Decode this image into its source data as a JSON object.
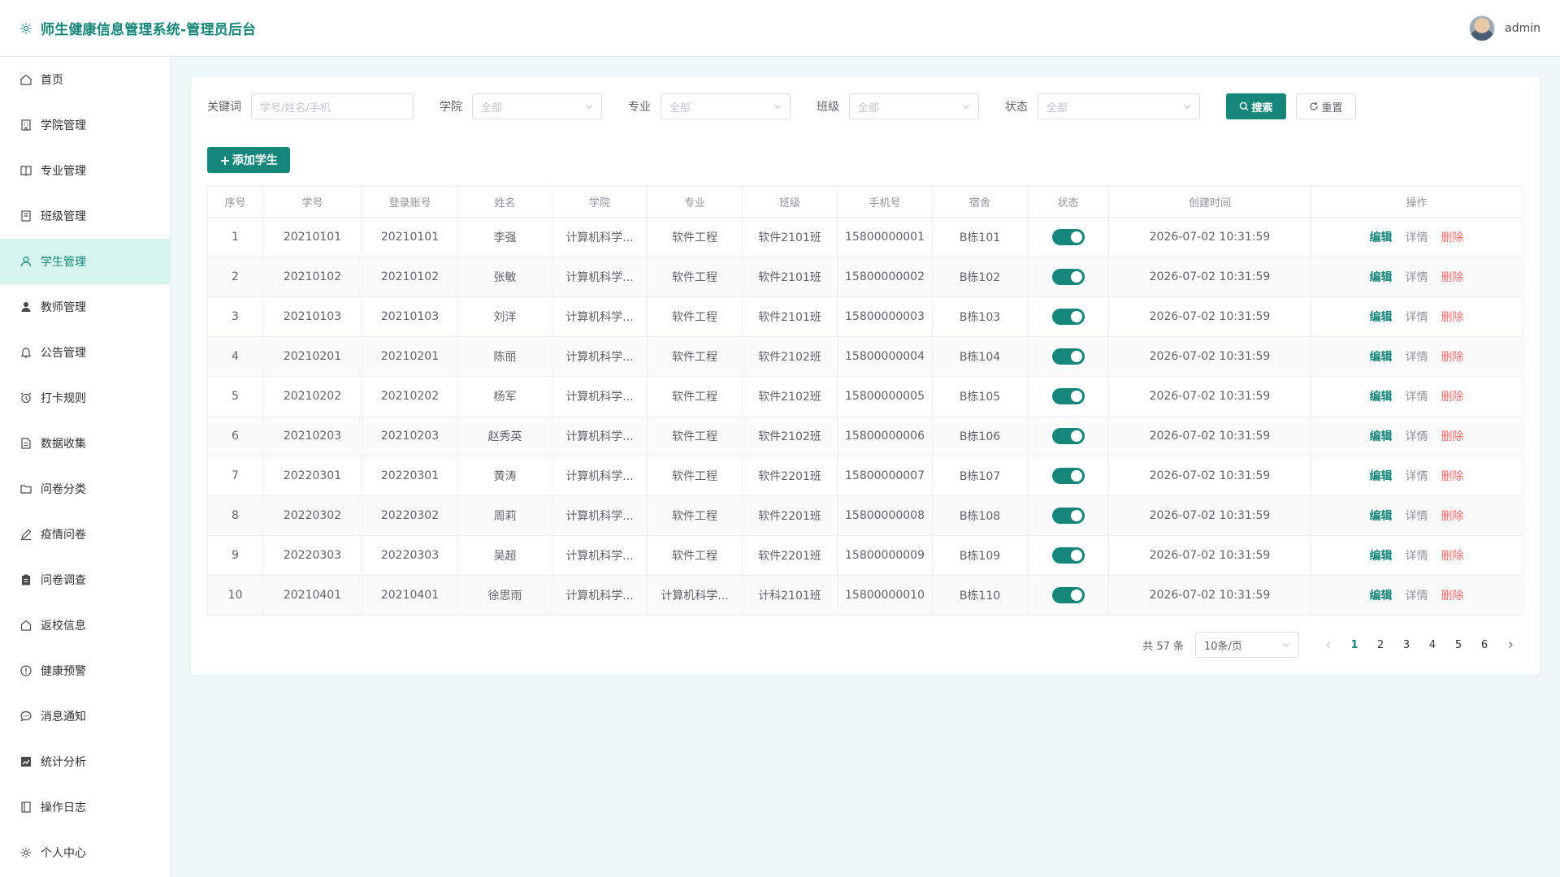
{
  "app": {
    "title": "师生健康信息管理系统-管理员后台"
  },
  "user": {
    "name": "admin"
  },
  "sidebar": {
    "items": [
      {
        "label": "首页",
        "icon": "home-icon"
      },
      {
        "label": "学院管理",
        "icon": "building-icon"
      },
      {
        "label": "专业管理",
        "icon": "book-icon"
      },
      {
        "label": "班级管理",
        "icon": "class-icon"
      },
      {
        "label": "学生管理",
        "icon": "user-icon",
        "active": true
      },
      {
        "label": "教师管理",
        "icon": "teacher-icon"
      },
      {
        "label": "公告管理",
        "icon": "bell-icon"
      },
      {
        "label": "打卡规则",
        "icon": "alarm-icon"
      },
      {
        "label": "数据收集",
        "icon": "document-icon"
      },
      {
        "label": "问卷分类",
        "icon": "folder-icon"
      },
      {
        "label": "疫情问卷",
        "icon": "pen-icon"
      },
      {
        "label": "问卷调查",
        "icon": "clipboard-icon"
      },
      {
        "label": "返校信息",
        "icon": "house-icon"
      },
      {
        "label": "健康预警",
        "icon": "warning-icon"
      },
      {
        "label": "消息通知",
        "icon": "message-icon"
      },
      {
        "label": "统计分析",
        "icon": "chart-icon"
      },
      {
        "label": "操作日志",
        "icon": "log-icon"
      },
      {
        "label": "个人中心",
        "icon": "gear-icon"
      }
    ]
  },
  "filters": {
    "keyword_label": "关键词",
    "keyword_placeholder": "学号/姓名/手机",
    "college_label": "学院",
    "college_value": "全部",
    "major_label": "专业",
    "major_value": "全部",
    "class_label": "班级",
    "class_value": "全部",
    "status_label": "状态",
    "status_value": "全部",
    "search_label": "搜索",
    "reset_label": "重置"
  },
  "add_button_label": "添加学生",
  "table": {
    "headers": [
      "序号",
      "学号",
      "登录账号",
      "姓名",
      "学院",
      "专业",
      "班级",
      "手机号",
      "宿舍",
      "状态",
      "创建时间",
      "操作"
    ],
    "actions": {
      "edit": "编辑",
      "detail": "详情",
      "delete": "删除"
    },
    "rows": [
      {
        "idx": "1",
        "sid": "20210101",
        "account": "20210101",
        "name": "李强",
        "college": "计算机科学...",
        "major": "软件工程",
        "class": "软件2101班",
        "phone": "15800000001",
        "dorm": "B栋101",
        "enabled": true,
        "created": "2026-07-02 10:31:59"
      },
      {
        "idx": "2",
        "sid": "20210102",
        "account": "20210102",
        "name": "张敏",
        "college": "计算机科学...",
        "major": "软件工程",
        "class": "软件2101班",
        "phone": "15800000002",
        "dorm": "B栋102",
        "enabled": true,
        "created": "2026-07-02 10:31:59"
      },
      {
        "idx": "3",
        "sid": "20210103",
        "account": "20210103",
        "name": "刘洋",
        "college": "计算机科学...",
        "major": "软件工程",
        "class": "软件2101班",
        "phone": "15800000003",
        "dorm": "B栋103",
        "enabled": true,
        "created": "2026-07-02 10:31:59"
      },
      {
        "idx": "4",
        "sid": "20210201",
        "account": "20210201",
        "name": "陈丽",
        "college": "计算机科学...",
        "major": "软件工程",
        "class": "软件2102班",
        "phone": "15800000004",
        "dorm": "B栋104",
        "enabled": true,
        "created": "2026-07-02 10:31:59"
      },
      {
        "idx": "5",
        "sid": "20210202",
        "account": "20210202",
        "name": "杨军",
        "college": "计算机科学...",
        "major": "软件工程",
        "class": "软件2102班",
        "phone": "15800000005",
        "dorm": "B栋105",
        "enabled": true,
        "created": "2026-07-02 10:31:59"
      },
      {
        "idx": "6",
        "sid": "20210203",
        "account": "20210203",
        "name": "赵秀英",
        "college": "计算机科学...",
        "major": "软件工程",
        "class": "软件2102班",
        "phone": "15800000006",
        "dorm": "B栋106",
        "enabled": true,
        "created": "2026-07-02 10:31:59"
      },
      {
        "idx": "7",
        "sid": "20220301",
        "account": "20220301",
        "name": "黄涛",
        "college": "计算机科学...",
        "major": "软件工程",
        "class": "软件2201班",
        "phone": "15800000007",
        "dorm": "B栋107",
        "enabled": true,
        "created": "2026-07-02 10:31:59"
      },
      {
        "idx": "8",
        "sid": "20220302",
        "account": "20220302",
        "name": "周莉",
        "college": "计算机科学...",
        "major": "软件工程",
        "class": "软件2201班",
        "phone": "15800000008",
        "dorm": "B栋108",
        "enabled": true,
        "created": "2026-07-02 10:31:59"
      },
      {
        "idx": "9",
        "sid": "20220303",
        "account": "20220303",
        "name": "吴超",
        "college": "计算机科学...",
        "major": "软件工程",
        "class": "软件2201班",
        "phone": "15800000009",
        "dorm": "B栋109",
        "enabled": true,
        "created": "2026-07-02 10:31:59"
      },
      {
        "idx": "10",
        "sid": "20210401",
        "account": "20210401",
        "name": "徐思雨",
        "college": "计算机科学...",
        "major": "计算机科学...",
        "class": "计科2101班",
        "phone": "15800000010",
        "dorm": "B栋110",
        "enabled": true,
        "created": "2026-07-02 10:31:59"
      }
    ]
  },
  "pagination": {
    "total_label": "共 57 条",
    "page_size_label": "10条/页",
    "pages": [
      "1",
      "2",
      "3",
      "4",
      "5",
      "6"
    ],
    "current": "1"
  },
  "colors": {
    "accent": "#17867a",
    "danger": "#f56c6c",
    "active_menu_bg": "#d6f4ee"
  }
}
